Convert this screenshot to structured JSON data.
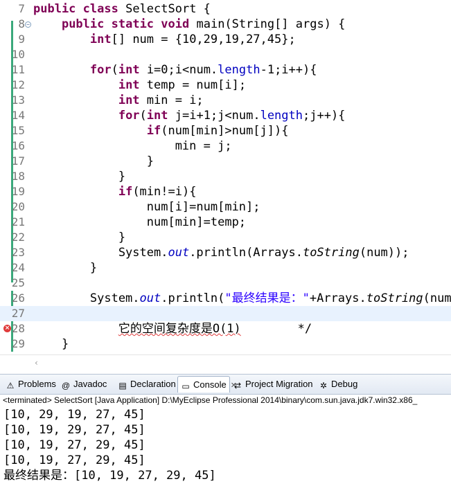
{
  "editor": {
    "lines": [
      {
        "num": "7",
        "tokens": [
          {
            "t": "public",
            "c": "kw"
          },
          {
            "t": " "
          },
          {
            "t": "class",
            "c": "kw"
          },
          {
            "t": " SelectSort {"
          }
        ]
      },
      {
        "num": "8",
        "tokens": [
          {
            "t": "    "
          },
          {
            "t": "public",
            "c": "kw"
          },
          {
            "t": " "
          },
          {
            "t": "static",
            "c": "kw"
          },
          {
            "t": " "
          },
          {
            "t": "void",
            "c": "kw"
          },
          {
            "t": " main(String[] args) {"
          }
        ]
      },
      {
        "num": "9",
        "tokens": [
          {
            "t": "        "
          },
          {
            "t": "int",
            "c": "kw"
          },
          {
            "t": "[] num = {10,29,19,27,45};"
          }
        ]
      },
      {
        "num": "10",
        "tokens": []
      },
      {
        "num": "11",
        "tokens": [
          {
            "t": "        "
          },
          {
            "t": "for",
            "c": "kw"
          },
          {
            "t": "("
          },
          {
            "t": "int",
            "c": "kw"
          },
          {
            "t": " i=0;i<num."
          },
          {
            "t": "length",
            "c": "fld"
          },
          {
            "t": "-1;i++){"
          }
        ]
      },
      {
        "num": "12",
        "tokens": [
          {
            "t": "            "
          },
          {
            "t": "int",
            "c": "kw"
          },
          {
            "t": " temp = num[i];"
          }
        ]
      },
      {
        "num": "13",
        "tokens": [
          {
            "t": "            "
          },
          {
            "t": "int",
            "c": "kw"
          },
          {
            "t": " min = i;"
          }
        ]
      },
      {
        "num": "14",
        "tokens": [
          {
            "t": "            "
          },
          {
            "t": "for",
            "c": "kw"
          },
          {
            "t": "("
          },
          {
            "t": "int",
            "c": "kw"
          },
          {
            "t": " j=i+1;j<num."
          },
          {
            "t": "length",
            "c": "fld"
          },
          {
            "t": ";j++){"
          }
        ]
      },
      {
        "num": "15",
        "tokens": [
          {
            "t": "                "
          },
          {
            "t": "if",
            "c": "kw"
          },
          {
            "t": "(num[min]>num[j]){"
          }
        ]
      },
      {
        "num": "16",
        "tokens": [
          {
            "t": "                    min = j;"
          }
        ]
      },
      {
        "num": "17",
        "tokens": [
          {
            "t": "                }"
          }
        ]
      },
      {
        "num": "18",
        "tokens": [
          {
            "t": "            }"
          }
        ]
      },
      {
        "num": "19",
        "tokens": [
          {
            "t": "            "
          },
          {
            "t": "if",
            "c": "kw"
          },
          {
            "t": "(min!=i){"
          }
        ]
      },
      {
        "num": "20",
        "tokens": [
          {
            "t": "                num[i]=num[min];"
          }
        ]
      },
      {
        "num": "21",
        "tokens": [
          {
            "t": "                num[min]=temp;"
          }
        ]
      },
      {
        "num": "22",
        "tokens": [
          {
            "t": "            }"
          }
        ]
      },
      {
        "num": "23",
        "tokens": [
          {
            "t": "            System."
          },
          {
            "t": "out",
            "c": "fldi"
          },
          {
            "t": ".println(Arrays."
          },
          {
            "t": "toString",
            "c": "mi"
          },
          {
            "t": "(num));"
          }
        ]
      },
      {
        "num": "24",
        "tokens": [
          {
            "t": "        }"
          }
        ]
      },
      {
        "num": "25",
        "tokens": []
      },
      {
        "num": "26",
        "tokens": [
          {
            "t": "        System."
          },
          {
            "t": "out",
            "c": "fldi"
          },
          {
            "t": ".println("
          },
          {
            "t": "\"最终结果是：\"",
            "c": "str"
          },
          {
            "t": "+Arrays."
          },
          {
            "t": "toString",
            "c": "mi"
          },
          {
            "t": "(num));"
          }
        ]
      },
      {
        "num": "27",
        "tokens": []
      },
      {
        "num": "28",
        "tokens": [
          {
            "t": "            "
          },
          {
            "t": "它的空间复杂度是O(1)",
            "c": "squig"
          },
          {
            "t": "        */"
          }
        ]
      },
      {
        "num": "29",
        "tokens": [
          {
            "t": "    }"
          }
        ]
      }
    ],
    "fold_marker": "−",
    "error_marker": "×",
    "scroll_arrow": "‹"
  },
  "panel": {
    "tabs": [
      {
        "label": "Problems",
        "icon": "⚠",
        "icon_name": "problems-icon"
      },
      {
        "label": "Javadoc",
        "icon": "@",
        "icon_name": "javadoc-icon"
      },
      {
        "label": "Declaration",
        "icon": "▤",
        "icon_name": "declaration-icon"
      },
      {
        "label": "Console",
        "icon": "▭",
        "icon_name": "console-icon",
        "close": "✕"
      },
      {
        "label": "Project Migration",
        "icon": "⇄",
        "icon_name": "project-migration-icon"
      },
      {
        "label": "Debug",
        "icon": "✲",
        "icon_name": "debug-icon"
      }
    ],
    "status": "<terminated> SelectSort [Java Application] D:\\MyEclipse Professional 2014\\binary\\com.sun.java.jdk7.win32.x86_",
    "output": [
      "[10, 29, 19, 27, 45]",
      "[10, 19, 29, 27, 45]",
      "[10, 19, 27, 29, 45]",
      "[10, 19, 27, 29, 45]",
      "最终结果是：[10, 19, 27, 29, 45]"
    ]
  },
  "colors": {
    "keyword": "#7f0055",
    "field": "#0000c0",
    "string": "#2a00ff",
    "current_line": "#e8f2fe",
    "change_bar": "#3aa87b"
  }
}
